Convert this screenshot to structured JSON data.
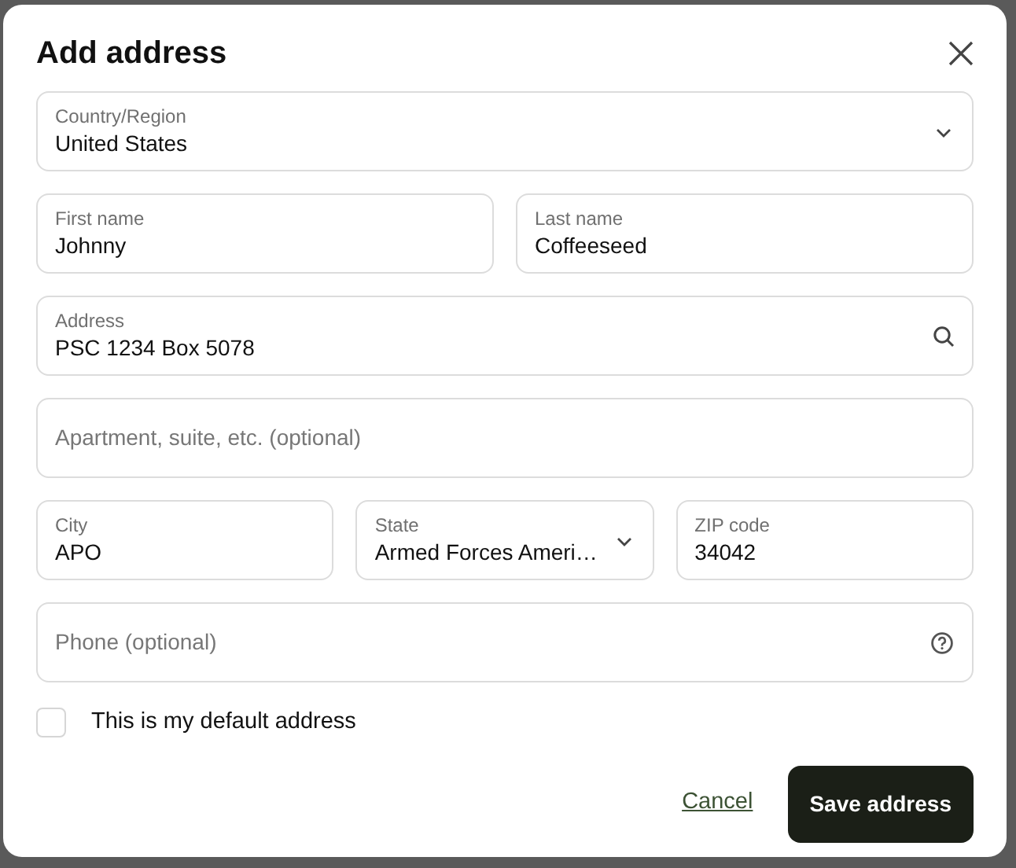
{
  "dialog": {
    "title": "Add address",
    "rows": [
      [
        {
          "kind": "select",
          "label": "Country/Region",
          "value": "United States"
        }
      ],
      [
        {
          "kind": "text",
          "label": "First name",
          "value": "Johnny"
        },
        {
          "kind": "text",
          "label": "Last name",
          "value": "Coffeeseed"
        }
      ],
      [
        {
          "kind": "search",
          "label": "Address",
          "value": "PSC 1234 Box 5078"
        }
      ],
      [
        {
          "kind": "text",
          "placeholder": "Apartment, suite, etc. (optional)"
        }
      ],
      [
        {
          "kind": "text",
          "label": "City",
          "value": "APO"
        },
        {
          "kind": "select",
          "label": "State",
          "value": "Armed Forces Ameri…"
        },
        {
          "kind": "text",
          "label": "ZIP code",
          "value": "34042"
        }
      ],
      [
        {
          "kind": "help",
          "placeholder": "Phone (optional)"
        }
      ]
    ],
    "default_checkbox": {
      "label": "This is my default address",
      "checked": false
    },
    "cancel": "Cancel",
    "save": "Save address"
  }
}
